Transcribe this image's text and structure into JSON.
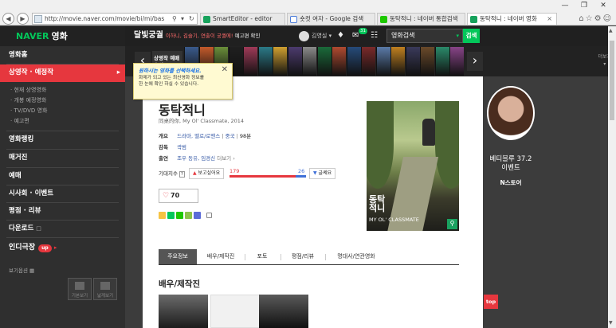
{
  "browser": {
    "url": "http://movie.naver.com/movie/bi/mi/basic.nhn?code",
    "tabs": [
      {
        "label": "SmartEditor - editor",
        "color": "#17a25c"
      },
      {
        "label": "숏컷 여자 - Google 검색",
        "color": "#4a7bd8"
      },
      {
        "label": "동탁적니 : 네이버 통합검색",
        "color": "#1ec800"
      },
      {
        "label": "동탁적니 : 네이버 영화",
        "color": "#17a25c"
      }
    ],
    "close_glyph": "×"
  },
  "gnb": {
    "brand": "달빛궁궐",
    "lead": "이하니, 김슬기, 연출이 궁궐에!",
    "link": "예고편 확인",
    "user": "김영실",
    "mail_count": "31",
    "search_value": "영화검색",
    "search_button": "검색"
  },
  "lnb": {
    "logo_naver": "NAVER",
    "logo_movie": "영화",
    "items": [
      {
        "label": "영화홈"
      },
      {
        "label": "상영작 · 예정작"
      },
      {
        "label": "영화랭킹"
      },
      {
        "label": "매거진"
      },
      {
        "label": "예매"
      },
      {
        "label": "시사회 · 이벤트"
      },
      {
        "label": "평점 · 리뷰"
      },
      {
        "label": "다운로드"
      }
    ],
    "subitems": [
      "현재 상영영화",
      "개봉 예정영화",
      "TV/DVD 영화",
      "예고편"
    ],
    "indie": "인디극장",
    "indie_badge": "up",
    "view_option": "보기옵션",
    "view_buttons": [
      "기본보기",
      "넓게보기"
    ]
  },
  "strip": {
    "rank_label": "상영작 예매 순위",
    "more": "더보기"
  },
  "tooltip": {
    "headline": "원하시는 영화를 선택하세요.",
    "body_line1": "화제가 되고 있는 최신영화 정보를",
    "body_line2": "한 눈에 확인 하실 수 있습니다."
  },
  "movie": {
    "title": "동탁적니",
    "subtitle": "同桌的你, My Ol' Classmate, 2014",
    "overview_label": "개요",
    "genres": "드라마, 멜로/로맨스",
    "country": "중국",
    "runtime": "98분",
    "director_label": "감독",
    "director": "곽범",
    "cast_label": "출연",
    "cast": "조우 동유, 임경신",
    "cast_more": "더보기",
    "expect_label": "기대지수",
    "want_button": "보고싶어요",
    "want_count": 179,
    "not_count": 26,
    "not_button": "글쎄요",
    "like_count": "70",
    "poster_title": "동탁적니",
    "poster_en": "MY OL' CLASSMATE"
  },
  "tabs": [
    "주요정보",
    "배우/제작진",
    "포토",
    "평점/리뷰",
    "명대사/연관영화"
  ],
  "section_title": "배우/제작진",
  "ad": {
    "line1": "베티블루 37.2",
    "line2": "이벤트",
    "line3": "N스토어"
  },
  "top_button": "top",
  "colors": {
    "accent": "#e6373e",
    "naver_green": "#03c75a",
    "link_blue": "#3559a6"
  }
}
